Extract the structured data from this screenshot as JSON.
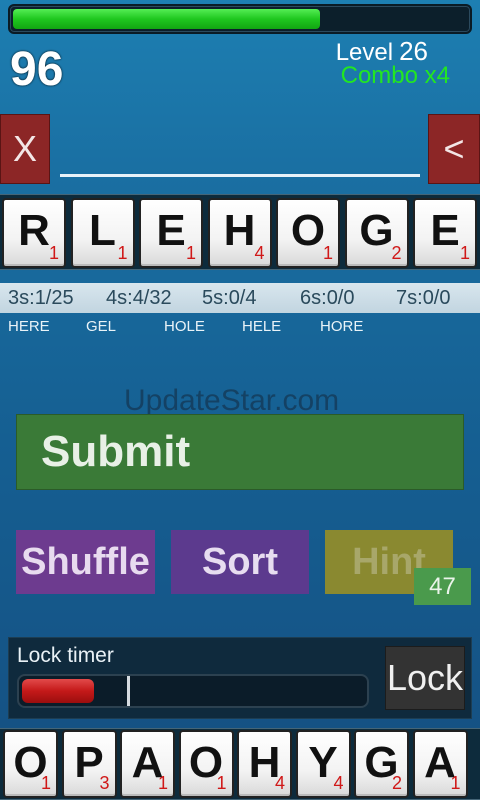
{
  "progress": {
    "fraction": 0.67,
    "color": "#1fc71f"
  },
  "score": "96",
  "level": {
    "label": "Level",
    "value": "26"
  },
  "combo": "Combo x4",
  "clear_button": "X",
  "backspace_button": "<",
  "current_word": "",
  "rack_tiles": [
    {
      "letter": "R",
      "points": "1"
    },
    {
      "letter": "L",
      "points": "1"
    },
    {
      "letter": "E",
      "points": "1"
    },
    {
      "letter": "H",
      "points": "4"
    },
    {
      "letter": "O",
      "points": "1"
    },
    {
      "letter": "G",
      "points": "2"
    },
    {
      "letter": "E",
      "points": "1"
    }
  ],
  "word_counts": [
    {
      "label": "3s:",
      "value": "1/25"
    },
    {
      "label": "4s:",
      "value": "4/32"
    },
    {
      "label": "5s:",
      "value": "0/4"
    },
    {
      "label": "6s:",
      "value": "0/0"
    },
    {
      "label": "7s:",
      "value": "0/0"
    }
  ],
  "found_words": [
    "HERE",
    "GEL",
    "HOLE",
    "HELE",
    "HORE"
  ],
  "watermark": "UpdateStar.com",
  "buttons": {
    "submit": "Submit",
    "shuffle": "Shuffle",
    "sort": "Sort",
    "hint": "Hint",
    "hint_count": "47"
  },
  "lock": {
    "label": "Lock timer",
    "button": "Lock",
    "fraction": 0.21,
    "marker_fraction": 0.31
  },
  "next_tiles": [
    {
      "letter": "O",
      "points": "1"
    },
    {
      "letter": "P",
      "points": "3"
    },
    {
      "letter": "A",
      "points": "1"
    },
    {
      "letter": "O",
      "points": "1"
    },
    {
      "letter": "H",
      "points": "4"
    },
    {
      "letter": "Y",
      "points": "4"
    },
    {
      "letter": "G",
      "points": "2"
    },
    {
      "letter": "A",
      "points": "1"
    }
  ],
  "colors": {
    "tile_points": "#d01818",
    "combo": "#22e622",
    "submit": "#3a7a37",
    "shuffle": "#6d3b8f",
    "sort": "#5c3a8e",
    "hint": "#8a8930",
    "clear": "#8c2626"
  }
}
